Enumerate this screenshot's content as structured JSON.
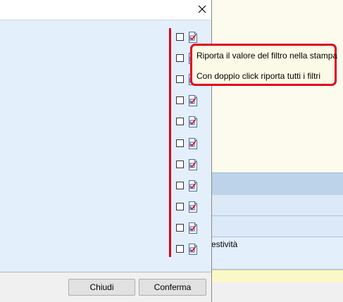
{
  "dialog": {
    "close_icon": "close-icon",
    "buttons": {
      "close_label": "Chiudi",
      "confirm_label": "Conferma"
    },
    "filter_rows": [
      {
        "checked": false,
        "icon": "print-filter-icon"
      },
      {
        "checked": false,
        "icon": "print-filter-icon"
      },
      {
        "checked": false,
        "icon": "print-filter-icon"
      },
      {
        "checked": false,
        "icon": "print-filter-icon"
      },
      {
        "checked": false,
        "icon": "print-filter-icon"
      },
      {
        "checked": false,
        "icon": "print-filter-icon"
      },
      {
        "checked": false,
        "icon": "print-filter-icon"
      },
      {
        "checked": false,
        "icon": "print-filter-icon"
      },
      {
        "checked": false,
        "icon": "print-filter-icon"
      },
      {
        "checked": false,
        "icon": "print-filter-icon"
      },
      {
        "checked": false,
        "icon": "print-filter-icon"
      }
    ]
  },
  "tooltip": {
    "line1": "Riporta il valore del filtro nella stampa",
    "line2": "Con doppio click riporta tutti i filtri"
  },
  "background": {
    "row_text": "estività"
  },
  "colors": {
    "highlight_red": "#d9001b",
    "dialog_content_bg": "#e4effc",
    "tooltip_bg": "#fbfae6",
    "background_panel": "#fcfbee",
    "background_header": "#bcd3ea",
    "background_footer_stripe": "#fbf8c8"
  }
}
